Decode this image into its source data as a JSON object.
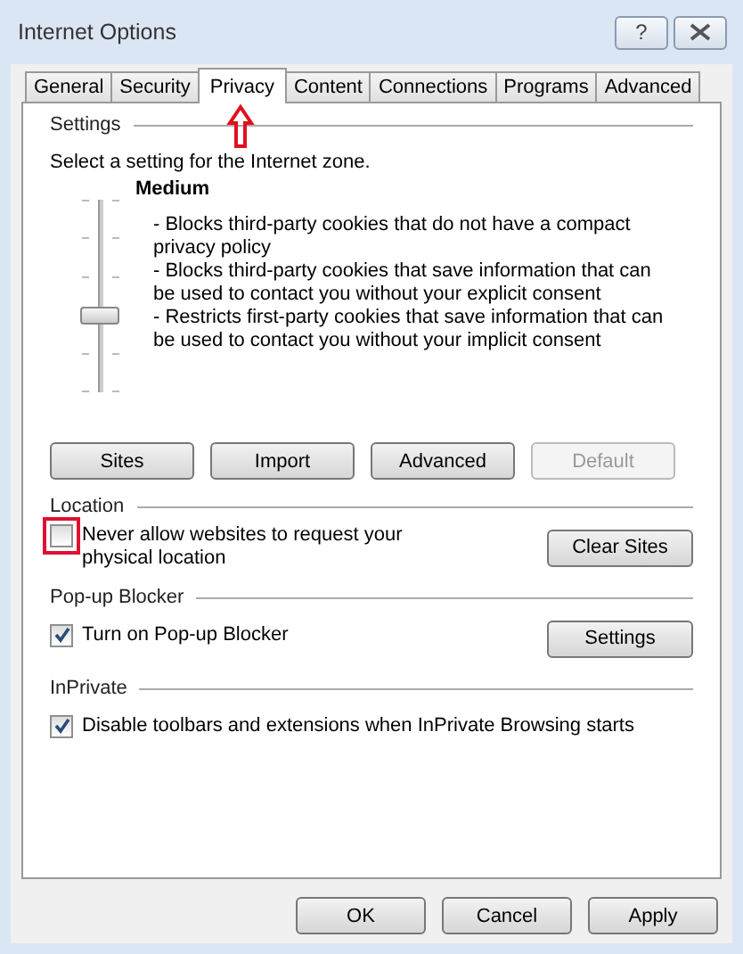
{
  "window": {
    "title": "Internet Options",
    "help_button": "?"
  },
  "tabs": [
    {
      "label": "General",
      "selected": false,
      "marked": false
    },
    {
      "label": "Security",
      "selected": false,
      "marked": false
    },
    {
      "label": "Privacy",
      "selected": true,
      "marked": true
    },
    {
      "label": "Content",
      "selected": false,
      "marked": false
    },
    {
      "label": "Connections",
      "selected": false,
      "marked": false
    },
    {
      "label": "Programs",
      "selected": false,
      "marked": false
    },
    {
      "label": "Advanced",
      "selected": false,
      "marked": false
    }
  ],
  "settings": {
    "heading": "Settings",
    "prompt": "Select a setting for the Internet zone.",
    "slider": {
      "level": 0.4
    },
    "level_name": "Medium",
    "description": [
      "- Blocks third-party cookies that do not have a compact privacy policy",
      "- Blocks third-party cookies that save information that can be used to contact you without your explicit consent",
      "- Restricts first-party cookies that save information that can be used to contact you without your implicit consent"
    ],
    "buttons": [
      {
        "label": "Sites",
        "disabled": false
      },
      {
        "label": "Import",
        "disabled": false
      },
      {
        "label": "Advanced",
        "disabled": false
      },
      {
        "label": "Default",
        "disabled": true
      }
    ]
  },
  "sections": [
    {
      "heading": "Location",
      "checkbox": {
        "label": "Never allow websites to request your physical location",
        "checked": false,
        "marked": true
      },
      "button": "Clear Sites"
    },
    {
      "heading": "Pop-up Blocker",
      "checkbox": {
        "label": "Turn on Pop-up Blocker",
        "checked": true
      },
      "button": "Settings"
    },
    {
      "heading": "InPrivate",
      "checkbox": {
        "label": "Disable toolbars and extensions when InPrivate Browsing starts",
        "checked": true
      }
    }
  ],
  "footer_buttons": [
    "OK",
    "Cancel",
    "Apply"
  ]
}
